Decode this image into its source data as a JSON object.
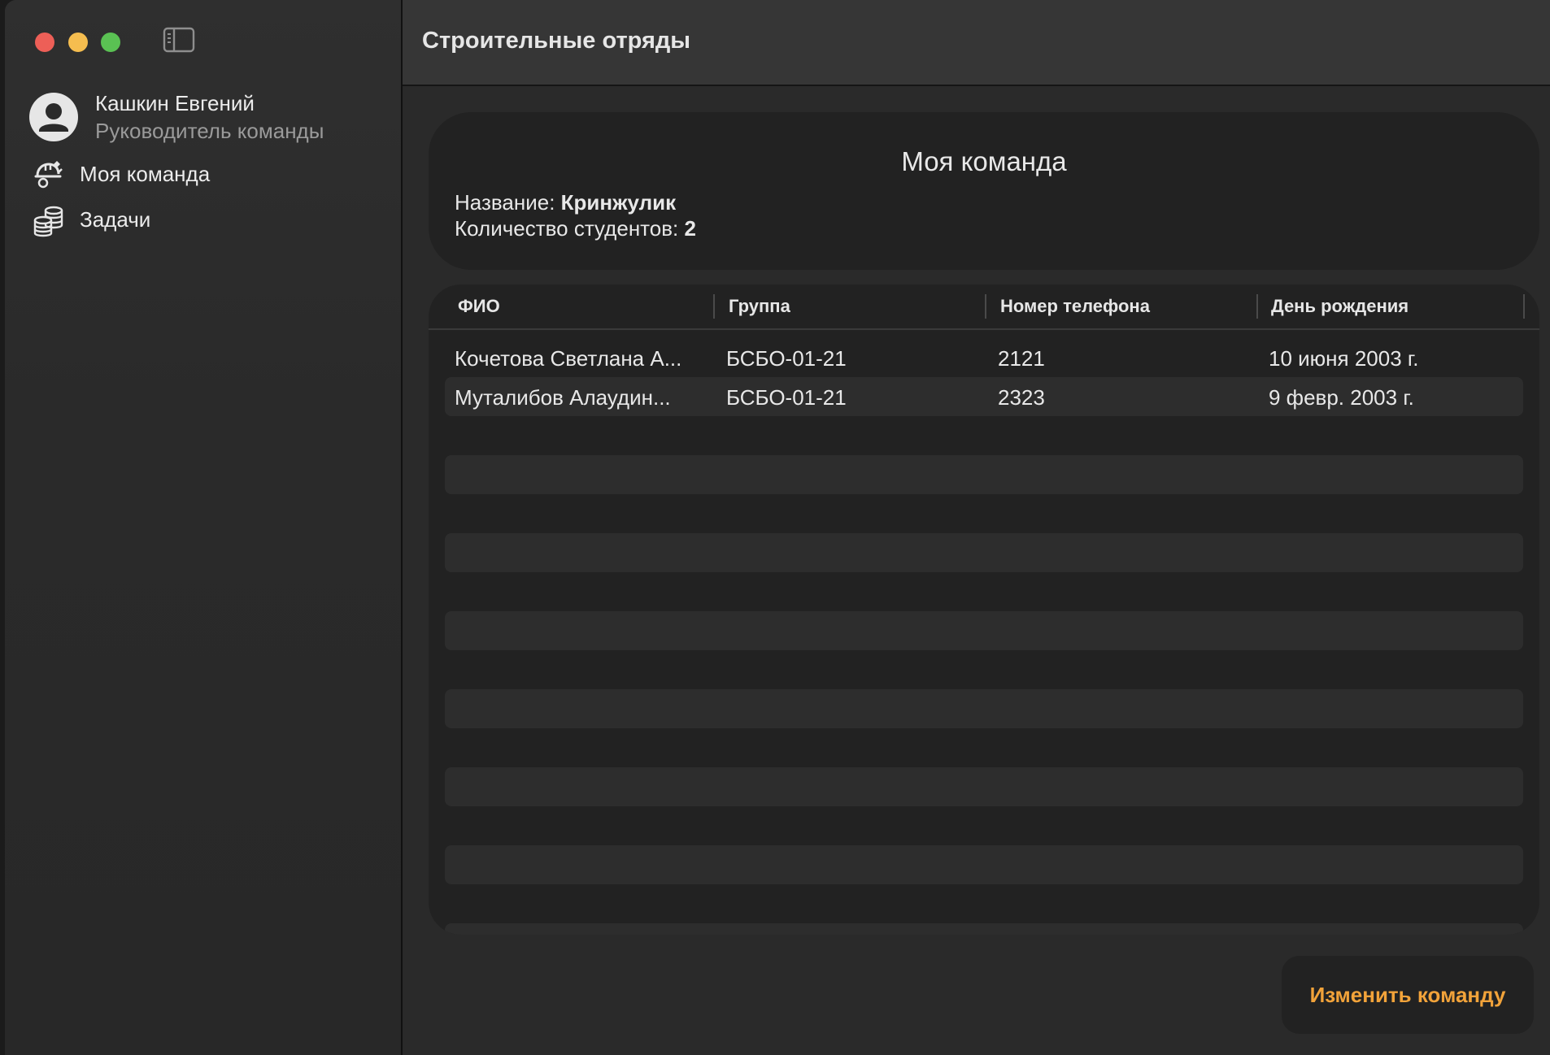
{
  "window": {
    "title": "Строительные отряды"
  },
  "sidebar": {
    "profile": {
      "name": "Кашкин Евгений",
      "role": "Руководитель команды"
    },
    "items": [
      {
        "label": "Моя команда",
        "icon": "team-helmet-icon"
      },
      {
        "label": "Задачи",
        "icon": "coins-stack-icon"
      }
    ]
  },
  "team_card": {
    "title": "Моя команда",
    "name_label": "Название:",
    "name_value": "Кринжулик",
    "count_label": "Количество студентов:",
    "count_value": "2"
  },
  "table": {
    "headers": [
      "ФИО",
      "Группа",
      "Номер телефона",
      "День рождения"
    ],
    "rows": [
      [
        "Кочетова Светлана А...",
        "БСБО-01-21",
        "2121",
        "10 июня 2003 г."
      ],
      [
        "Муталибов Алаудин...",
        "БСБО-01-21",
        "2323",
        "9 февр. 2003 г."
      ]
    ]
  },
  "actions": {
    "edit_team": "Изменить команду"
  },
  "colors": {
    "accent": "#f2a33a",
    "close": "#ed5f57",
    "minimize": "#f5bd4f",
    "maximize": "#5ac153"
  }
}
